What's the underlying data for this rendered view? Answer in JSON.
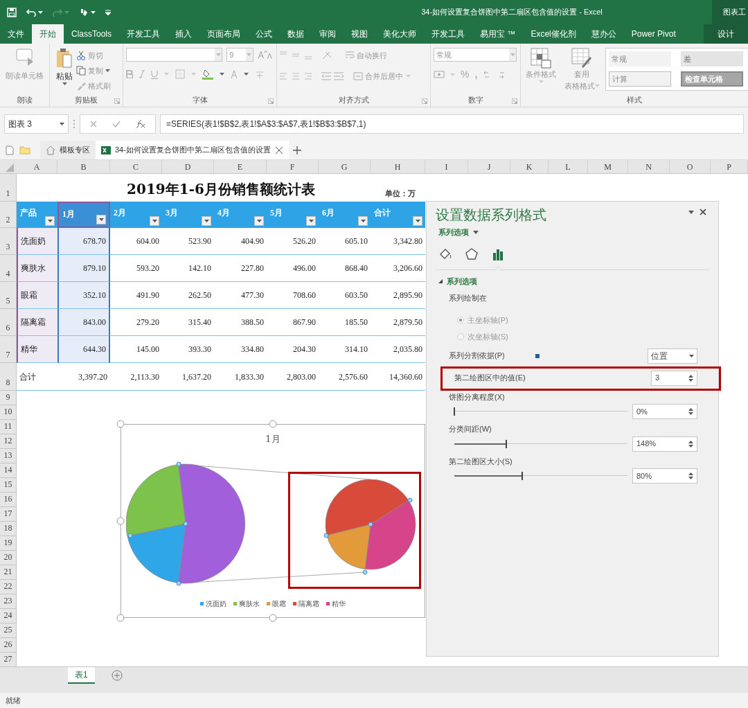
{
  "title_bar": {
    "title": "34-如何设置复合饼图中第二扇区包含值的设置 - Excel",
    "context_label": "图表工"
  },
  "menu_tabs": [
    {
      "label": "文件",
      "selected": false
    },
    {
      "label": "开始",
      "selected": true
    },
    {
      "label": "ClassTools",
      "selected": false
    },
    {
      "label": "开发工具",
      "selected": false
    },
    {
      "label": "插入",
      "selected": false
    },
    {
      "label": "页面布局",
      "selected": false
    },
    {
      "label": "公式",
      "selected": false
    },
    {
      "label": "数据",
      "selected": false
    },
    {
      "label": "审阅",
      "selected": false
    },
    {
      "label": "视图",
      "selected": false
    },
    {
      "label": "美化大师",
      "selected": false
    },
    {
      "label": "开发工具",
      "selected": false
    },
    {
      "label": "易用宝 ™",
      "selected": false
    },
    {
      "label": "Excel催化剂",
      "selected": false
    },
    {
      "label": "慧办公",
      "selected": false
    },
    {
      "label": "Power Pivot",
      "selected": false
    },
    {
      "label": "设计",
      "selected": false,
      "kind": "context"
    }
  ],
  "ribbon": {
    "read_aloud": {
      "button": "朗读单元格",
      "group": "朗读"
    },
    "clipboard": {
      "paste": "粘贴",
      "cut": "剪切",
      "copy": "复制",
      "format_painter": "格式刷",
      "group": "剪贴板"
    },
    "font": {
      "size": "9",
      "group": "字体"
    },
    "alignment": {
      "wrap": "自动换行",
      "merge": "合并后居中",
      "group": "对齐方式"
    },
    "number": {
      "format": "常规",
      "percent": "%",
      "comma": ",",
      "group": "数字"
    },
    "styles": {
      "conditional": "条件格式",
      "table_format_1": "套用",
      "table_format_2": "表格格式",
      "gallery": [
        "常规",
        "差",
        "计算",
        "检查单元格"
      ],
      "group": "样式"
    }
  },
  "formula_bar": {
    "name_box": "图表 3",
    "formula": "=SERIES(表1!$B$2,表1!$A$3:$A$7,表1!$B$3:$B$7,1)"
  },
  "doc_tabs": [
    {
      "label": "模板专区",
      "selected": false,
      "kind": "home"
    },
    {
      "label": "34-如何设置复合饼图中第二扇区包含值的设置",
      "selected": true,
      "kind": "workbook"
    }
  ],
  "sheet": {
    "column_letters": [
      "A",
      "B",
      "C",
      "D",
      "E",
      "F",
      "G",
      "H",
      "I",
      "J",
      "K",
      "L",
      "M",
      "N",
      "O",
      "P"
    ],
    "row_numbers": [
      "1",
      "2",
      "3",
      "4",
      "5",
      "6",
      "7",
      "8",
      "9",
      "10",
      "11",
      "12",
      "13",
      "14",
      "15",
      "16",
      "17",
      "18",
      "19",
      "20",
      "21",
      "22",
      "23",
      "24",
      "25",
      "26",
      "27"
    ],
    "title": "2019年1-6月份销售额统计表",
    "unit": "单位：万",
    "columns": [
      {
        "label": "产品",
        "kind": "category"
      },
      {
        "label": "1月",
        "kind": "series"
      },
      {
        "label": "2月",
        "kind": "plain"
      },
      {
        "label": "3月",
        "kind": "plain"
      },
      {
        "label": "4月",
        "kind": "plain"
      },
      {
        "label": "5月",
        "kind": "plain"
      },
      {
        "label": "6月",
        "kind": "plain"
      },
      {
        "label": "合计",
        "kind": "plain"
      }
    ],
    "rows": [
      [
        "洗面奶",
        "678.70",
        "604.00",
        "523.90",
        "404.90",
        "526.20",
        "605.10",
        "3,342.80"
      ],
      [
        "爽肤水",
        "879.10",
        "593.20",
        "142.10",
        "227.80",
        "496.00",
        "868.40",
        "3,206.60"
      ],
      [
        "眼霜",
        "352.10",
        "491.90",
        "262.50",
        "477.30",
        "708.60",
        "603.50",
        "2,895.90"
      ],
      [
        "隔离霜",
        "843.00",
        "279.20",
        "315.40",
        "388.50",
        "867.90",
        "185.50",
        "2,879.50"
      ],
      [
        "精华",
        "644.30",
        "145.00",
        "393.30",
        "334.80",
        "204.30",
        "314.10",
        "2,035.80"
      ]
    ],
    "total_row": [
      "合计",
      "3,397.20",
      "2,113.30",
      "1,637.20",
      "1,833.30",
      "2,803.00",
      "2,576.60",
      "14,360.60"
    ]
  },
  "chart": {
    "title": "1月",
    "selected": true,
    "second_plot_highlighted": true,
    "legend": [
      {
        "label": "洗面奶",
        "color": "#2ea6e8"
      },
      {
        "label": "爽肤水",
        "color": "#7dc24a"
      },
      {
        "label": "眼霜",
        "color": "#e39a3a"
      },
      {
        "label": "隔离霜",
        "color": "#d84a3a"
      },
      {
        "label": "精华",
        "color": "#d6448a"
      }
    ]
  },
  "format_pane": {
    "title": "设置数据系列格式",
    "options_menu": "系列选项",
    "tabs": [
      {
        "kind": "fill",
        "selected": false
      },
      {
        "kind": "effects",
        "selected": false
      },
      {
        "kind": "options",
        "selected": true
      }
    ],
    "section": {
      "label": "系列选项",
      "expanded": true
    },
    "plot_on": {
      "label": "系列绘制在",
      "options": [
        {
          "label": "主坐标轴(P)",
          "selected": true,
          "disabled": true
        },
        {
          "label": "次坐标轴(S)",
          "selected": false,
          "disabled": true
        }
      ]
    },
    "split_by": {
      "label": "系列分割依据(P)",
      "value": "位置"
    },
    "second_plot_values": {
      "label": "第二绘图区中的值(E)",
      "value": "3",
      "highlighted": true
    },
    "sliders": [
      {
        "label": "饼图分离程度(X)",
        "level": 0,
        "value": "0%"
      },
      {
        "label": "分类间距(W)",
        "level": 0.3,
        "value": "148%"
      },
      {
        "label": "第二绘图区大小(S)",
        "level": 0.39,
        "value": "80%"
      }
    ]
  },
  "sheet_tabs": [
    {
      "label": "表1",
      "selected": true
    }
  ],
  "status_bar": {
    "text": "就绪"
  }
}
